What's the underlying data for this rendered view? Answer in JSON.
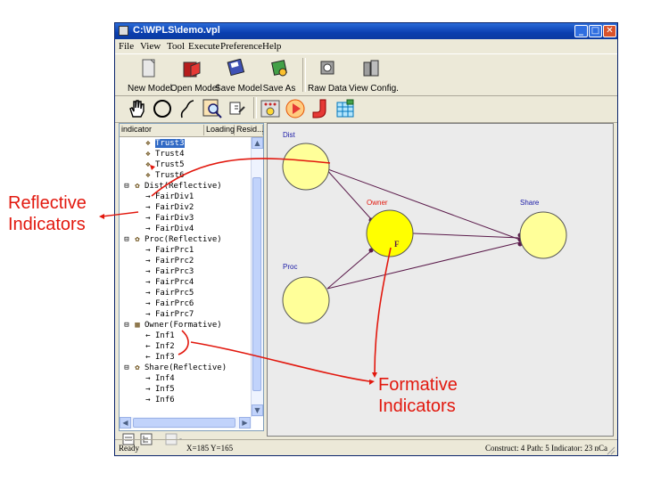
{
  "window": {
    "title": "C:\\WPLS\\demo.vpl",
    "minimize": "_",
    "maximize": "□",
    "close": "✕"
  },
  "menu": {
    "items": [
      "File",
      "View",
      "Tool",
      "Execute",
      "Preference",
      "Help"
    ]
  },
  "toolbar": {
    "buttons": [
      {
        "label": "New Model",
        "icon": "new-model-icon"
      },
      {
        "label": "Open Model",
        "icon": "open-model-icon"
      },
      {
        "label": "Save Model",
        "icon": "save-model-icon"
      },
      {
        "label": "Save As",
        "icon": "save-as-icon"
      },
      {
        "label": "Raw Data",
        "icon": "raw-data-icon"
      },
      {
        "label": "View Config.",
        "icon": "view-config-icon"
      }
    ],
    "tools": [
      "hand-icon",
      "circle-icon",
      "curve-icon",
      "inspect-icon",
      "edit-icon",
      "calculate-icon",
      "run-icon",
      "export-icon",
      "spreadsheet-icon"
    ]
  },
  "tree": {
    "columns": [
      "indicator",
      "Loading",
      "Resid..."
    ],
    "rows": [
      {
        "text": "Trust3",
        "level": 1,
        "icon": "indicator-stack-icon",
        "selected": true
      },
      {
        "text": "Trust4",
        "level": 1,
        "icon": "indicator-stack-icon"
      },
      {
        "text": "Trust5",
        "level": 1,
        "icon": "indicator-stack-icon"
      },
      {
        "text": "Trust6",
        "level": 1,
        "icon": "indicator-stack-icon"
      },
      {
        "text": "Dist(Reflective)",
        "level": 0,
        "icon": "construct-icon",
        "expander": "⊟"
      },
      {
        "text": "FairDiv1",
        "level": 1,
        "icon": "arrow-right-icon"
      },
      {
        "text": "FairDiv2",
        "level": 1,
        "icon": "arrow-right-icon"
      },
      {
        "text": "FairDiv3",
        "level": 1,
        "icon": "arrow-right-icon"
      },
      {
        "text": "FairDiv4",
        "level": 1,
        "icon": "arrow-right-icon"
      },
      {
        "text": "Proc(Reflective)",
        "level": 0,
        "icon": "construct-icon",
        "expander": "⊟"
      },
      {
        "text": "FairPrc1",
        "level": 1,
        "icon": "arrow-right-icon"
      },
      {
        "text": "FairPrc2",
        "level": 1,
        "icon": "arrow-right-icon"
      },
      {
        "text": "FairPrc3",
        "level": 1,
        "icon": "arrow-right-icon"
      },
      {
        "text": "FairPrc4",
        "level": 1,
        "icon": "arrow-right-icon"
      },
      {
        "text": "FairPrc5",
        "level": 1,
        "icon": "arrow-right-icon"
      },
      {
        "text": "FairPrc6",
        "level": 1,
        "icon": "arrow-right-icon"
      },
      {
        "text": "FairPrc7",
        "level": 1,
        "icon": "arrow-right-icon"
      },
      {
        "text": "Owner(Formative)",
        "level": 0,
        "icon": "formative-construct-icon",
        "expander": "⊟"
      },
      {
        "text": "Inf1",
        "level": 1,
        "icon": "arrow-left-icon"
      },
      {
        "text": "Inf2",
        "level": 1,
        "icon": "arrow-left-icon"
      },
      {
        "text": "Inf3",
        "level": 1,
        "icon": "arrow-left-icon"
      },
      {
        "text": "Share(Reflective)",
        "level": 0,
        "icon": "construct-icon",
        "expander": "⊟"
      },
      {
        "text": "Inf4",
        "level": 1,
        "icon": "arrow-right-icon"
      },
      {
        "text": "Inf5",
        "level": 1,
        "icon": "arrow-right-icon"
      },
      {
        "text": "Inf6",
        "level": 1,
        "icon": "arrow-right-icon"
      }
    ]
  },
  "canvas": {
    "nodes": [
      {
        "id": "dist",
        "label": "Dist",
        "color": "#ffff99"
      },
      {
        "id": "owner",
        "label": "Owner",
        "color": "#ffff00",
        "marker": "F"
      },
      {
        "id": "share",
        "label": "Share",
        "color": "#ffff99"
      },
      {
        "id": "proc",
        "label": "Proc",
        "color": "#ffff99"
      }
    ],
    "label_color": "#1a1aa6",
    "owner_label_color": "#e2180e",
    "path_color": "#5a1a4a"
  },
  "status": {
    "ready": "Ready",
    "coords": "X=185 Y=165",
    "counts": "Construct: 4  Path: 5  Indicator: 23 nCa"
  },
  "annotations": {
    "reflective": [
      "Reflective",
      "Indicators"
    ],
    "formative": [
      "Formative",
      "Indicators"
    ],
    "color": "#e2180e"
  }
}
